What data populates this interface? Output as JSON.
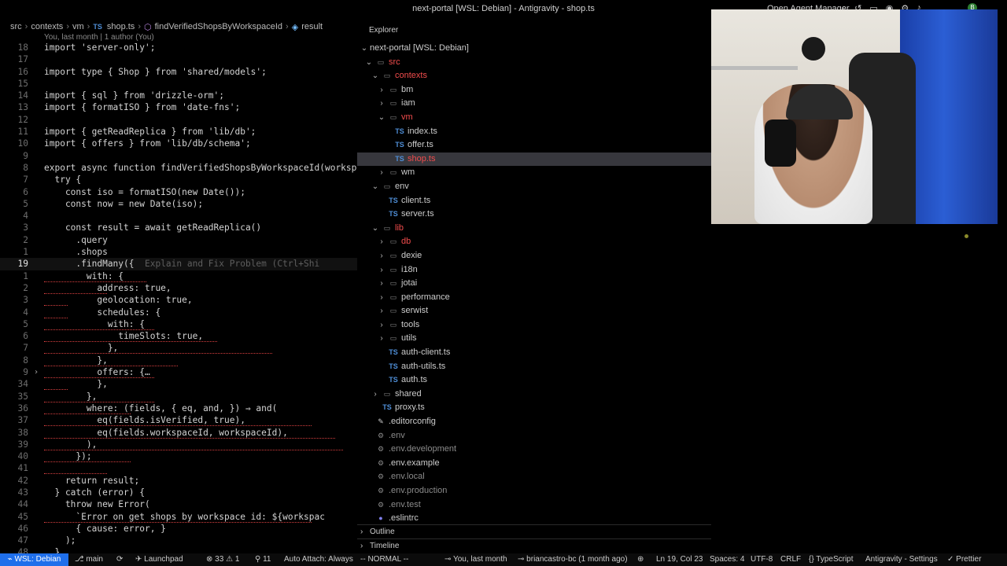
{
  "window": {
    "title": "next-portal [WSL: Debian] - Antigravity - shop.ts",
    "agent_manager": "Open Agent Manager",
    "avatar_initial": "B"
  },
  "breadcrumb": [
    "src",
    "contexts",
    "vm",
    "shop.ts",
    "findVerifiedShopsByWorkspaceId",
    "result"
  ],
  "blame": "You, last month | 1 author (You)",
  "code_lines": [
    {
      "n": "18",
      "t": "import 'server-only';"
    },
    {
      "n": "17",
      "t": ""
    },
    {
      "n": "16",
      "t": "import type { Shop } from 'shared/models';"
    },
    {
      "n": "15",
      "t": ""
    },
    {
      "n": "14",
      "t": "import { sql } from 'drizzle-orm';"
    },
    {
      "n": "13",
      "t": "import { formatISO } from 'date-fns';"
    },
    {
      "n": "12",
      "t": ""
    },
    {
      "n": "11",
      "t": "import { getReadReplica } from 'lib/db';"
    },
    {
      "n": "10",
      "t": "import { offers } from 'lib/db/schema';"
    },
    {
      "n": "9",
      "t": ""
    },
    {
      "n": "8",
      "t": "export async function findVerifiedShopsByWorkspaceId(worksp"
    },
    {
      "n": "7",
      "t": "  try {"
    },
    {
      "n": "6",
      "t": "    const iso = formatISO(new Date());"
    },
    {
      "n": "5",
      "t": "    const now = new Date(iso);"
    },
    {
      "n": "4",
      "t": ""
    },
    {
      "n": "3",
      "t": "    const result = await getReadReplica()"
    },
    {
      "n": "2",
      "t": "      .query"
    },
    {
      "n": "1",
      "t": "      .shops"
    },
    {
      "n": "19",
      "t": "      .findMany({  ",
      "ghost": "Explain and Fix Problem (Ctrl+Shi",
      "active": true
    },
    {
      "n": "1",
      "t": "        with: {"
    },
    {
      "n": "2",
      "t": "          address: true,"
    },
    {
      "n": "3",
      "t": "          geolocation: true,"
    },
    {
      "n": "4",
      "t": "          schedules: {"
    },
    {
      "n": "5",
      "t": "            with: {"
    },
    {
      "n": "6",
      "t": "              timeSlots: true,"
    },
    {
      "n": "7",
      "t": "            },"
    },
    {
      "n": "8",
      "t": "          },"
    },
    {
      "n": "9",
      "t": "          offers: {…",
      "fold": true
    },
    {
      "n": "34",
      "t": "          },"
    },
    {
      "n": "35",
      "t": "        },"
    },
    {
      "n": "36",
      "t": "        where: (fields, { eq, and, }) ⇒ and("
    },
    {
      "n": "37",
      "t": "          eq(fields.isVerified, true),"
    },
    {
      "n": "38",
      "t": "          eq(fields.workspaceId, workspaceId),"
    },
    {
      "n": "39",
      "t": "        ),"
    },
    {
      "n": "40",
      "t": "      });"
    },
    {
      "n": "41",
      "t": ""
    },
    {
      "n": "42",
      "t": "    return result;"
    },
    {
      "n": "43",
      "t": "  } catch (error) {"
    },
    {
      "n": "44",
      "t": "    throw new Error("
    },
    {
      "n": "45",
      "t": "      `Error on get shops by workspace id: ${workspac"
    },
    {
      "n": "46",
      "t": "      { cause: error, }"
    },
    {
      "n": "47",
      "t": "    );"
    },
    {
      "n": "48",
      "t": "  }"
    }
  ],
  "explorer": {
    "title": "Explorer",
    "root": "next-portal [WSL: Debian]",
    "items": [
      {
        "label": "src",
        "depth": 0,
        "type": "folder-open",
        "red": true
      },
      {
        "label": "contexts",
        "depth": 1,
        "type": "folder-open",
        "red": true
      },
      {
        "label": "bm",
        "depth": 2,
        "type": "folder"
      },
      {
        "label": "iam",
        "depth": 2,
        "type": "folder"
      },
      {
        "label": "vm",
        "depth": 2,
        "type": "folder-open",
        "red": true
      },
      {
        "label": "index.ts",
        "depth": 3,
        "type": "ts"
      },
      {
        "label": "offer.ts",
        "depth": 3,
        "type": "ts"
      },
      {
        "label": "shop.ts",
        "depth": 3,
        "type": "ts",
        "red": true,
        "selected": true
      },
      {
        "label": "wm",
        "depth": 2,
        "type": "folder"
      },
      {
        "label": "env",
        "depth": 1,
        "type": "folder-open"
      },
      {
        "label": "client.ts",
        "depth": 2,
        "type": "ts"
      },
      {
        "label": "server.ts",
        "depth": 2,
        "type": "ts"
      },
      {
        "label": "lib",
        "depth": 1,
        "type": "folder-open",
        "red": true
      },
      {
        "label": "db",
        "depth": 2,
        "type": "folder",
        "red": true
      },
      {
        "label": "dexie",
        "depth": 2,
        "type": "folder"
      },
      {
        "label": "i18n",
        "depth": 2,
        "type": "folder"
      },
      {
        "label": "jotai",
        "depth": 2,
        "type": "folder"
      },
      {
        "label": "performance",
        "depth": 2,
        "type": "folder"
      },
      {
        "label": "serwist",
        "depth": 2,
        "type": "folder"
      },
      {
        "label": "tools",
        "depth": 2,
        "type": "folder"
      },
      {
        "label": "utils",
        "depth": 2,
        "type": "folder"
      },
      {
        "label": "auth-client.ts",
        "depth": 2,
        "type": "ts"
      },
      {
        "label": "auth-utils.ts",
        "depth": 2,
        "type": "ts"
      },
      {
        "label": "auth.ts",
        "depth": 2,
        "type": "ts"
      },
      {
        "label": "shared",
        "depth": 1,
        "type": "folder"
      },
      {
        "label": "proxy.ts",
        "depth": 1,
        "type": "ts"
      },
      {
        "label": ".editorconfig",
        "depth": 0,
        "type": "config"
      },
      {
        "label": ".env",
        "depth": 0,
        "type": "gear",
        "dim": true
      },
      {
        "label": ".env.development",
        "depth": 0,
        "type": "gear",
        "dim": true
      },
      {
        "label": ".env.example",
        "depth": 0,
        "type": "gear"
      },
      {
        "label": ".env.local",
        "depth": 0,
        "type": "gear",
        "dim": true
      },
      {
        "label": ".env.production",
        "depth": 0,
        "type": "gear",
        "dim": true
      },
      {
        "label": ".env.test",
        "depth": 0,
        "type": "gear",
        "dim": true
      },
      {
        "label": ".eslintrc",
        "depth": 0,
        "type": "eslint"
      }
    ],
    "outline_label": "Outline",
    "timeline_label": "Timeline"
  },
  "statusbar": {
    "remote": "WSL: Debian",
    "branch": "main",
    "launchpad": "Launchpad",
    "errors": "33",
    "warnings": "1",
    "ports": "11",
    "auto_attach": "Auto Attach: Always",
    "mode": "-- NORMAL --",
    "blame": "You, last month",
    "author": "briancastro-bc (1 month ago)",
    "position": "Ln 19, Col 23",
    "spaces": "Spaces: 4",
    "encoding": "UTF-8",
    "eol": "CRLF",
    "language": "TypeScript",
    "settings": "Antigravity - Settings",
    "prettier": "Prettier"
  }
}
